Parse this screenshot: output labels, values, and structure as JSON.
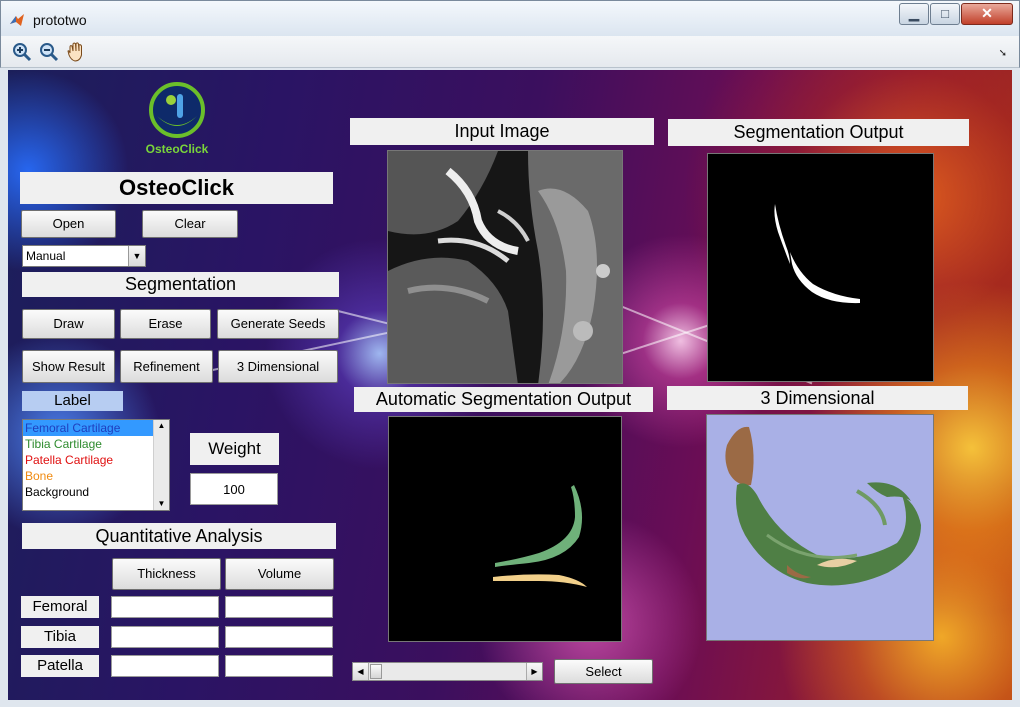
{
  "window": {
    "title": "prototwo",
    "minimize": "▁",
    "maximize": "□",
    "close": "✕"
  },
  "toolbar": {
    "icons": [
      "zoom-in-icon",
      "zoom-out-icon",
      "pan-hand-icon"
    ],
    "dock_arrow": "➘"
  },
  "logo": {
    "text": "OsteoClick"
  },
  "app_title": "OsteoClick",
  "controls": {
    "open": "Open",
    "clear": "Clear",
    "mode_select": "Manual",
    "segmentation_heading": "Segmentation",
    "draw": "Draw",
    "erase": "Erase",
    "generate_seeds": "Generate Seeds",
    "show_result": "Show Result",
    "refinement": "Refinement",
    "three_d": "3 Dimensional",
    "label_heading": "Label",
    "weight_heading": "Weight",
    "weight_value": "100"
  },
  "labels": [
    {
      "text": "Femoral Cartilage",
      "color": "#1f3fbf",
      "selected": true
    },
    {
      "text": "Tibia Cartilage",
      "color": "#2e8b2e",
      "selected": false
    },
    {
      "text": "Patella Cartilage",
      "color": "#e01010",
      "selected": false
    },
    {
      "text": "Bone",
      "color": "#f08a10",
      "selected": false
    },
    {
      "text": "Background",
      "color": "#000000",
      "selected": false
    }
  ],
  "analysis": {
    "heading": "Quantitative Analysis",
    "thickness": "Thickness",
    "volume": "Volume",
    "rows": [
      {
        "name": "Femoral",
        "thickness": "",
        "volume": ""
      },
      {
        "name": "Tibia",
        "thickness": "",
        "volume": ""
      },
      {
        "name": "Patella",
        "thickness": "",
        "volume": ""
      }
    ]
  },
  "panels": {
    "input": "Input Image",
    "segmentation": "Segmentation Output",
    "automatic": "Automatic Segmentation Output",
    "three_d": "3 Dimensional"
  },
  "bottom": {
    "select": "Select"
  },
  "colors": {
    "femoral": "#2e7a2e",
    "bone_overlay": "#f2d08a",
    "mesh_green": "#4f7f45",
    "mesh_brown": "#9b6a45",
    "render_bg": "#a9b0e6"
  }
}
